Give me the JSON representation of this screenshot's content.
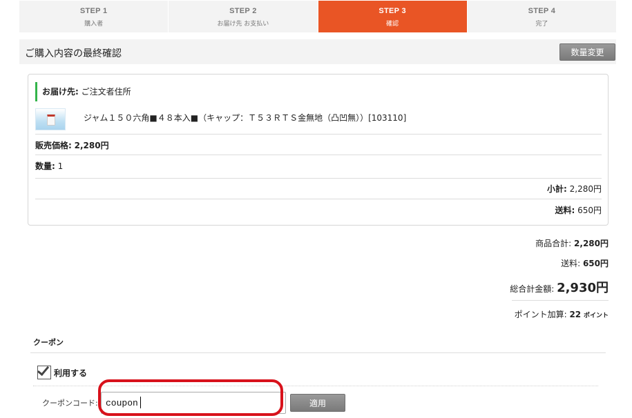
{
  "steps": [
    {
      "num": "STEP 1",
      "label": "購入者"
    },
    {
      "num": "STEP 2",
      "label": "お届け先 お支払い"
    },
    {
      "num": "STEP 3",
      "label": "確認"
    },
    {
      "num": "STEP 4",
      "label": "完了"
    }
  ],
  "active_step_color": "#e95525",
  "section": {
    "title": "ご購入内容の最終確認",
    "qty_change_button": "数量変更"
  },
  "order": {
    "destination_label": "お届け先:",
    "destination_value": "ご注文者住所",
    "product_name": "ジャム１５０六角■４８本入■（キャップ：Ｔ５３ＲＴＳ金無地（凸凹無））[103110]",
    "price_label": "販売価格:",
    "price_value": "2,280円",
    "qty_label": "数量:",
    "qty_value": "1",
    "subtotal_label": "小計:",
    "subtotal_value": "2,280円",
    "shipping_label": "送料:",
    "shipping_value": "650円"
  },
  "totals": {
    "items_total_label": "商品合計:",
    "items_total_value": "2,280円",
    "shipping_label": "送料:",
    "shipping_value": "650円",
    "grand_total_label": "総合計金額:",
    "grand_total_value": "2,930円",
    "points_label": "ポイント加算:",
    "points_value": "22",
    "points_unit": "ポイント"
  },
  "coupon": {
    "title": "クーポン",
    "use_label": "利用する",
    "use_checked": true,
    "code_label": "クーポンコード:",
    "code_value": "coupon",
    "apply_button": "適用"
  },
  "colors": {
    "accent": "#e95525",
    "destination_bar": "#33b44a",
    "highlight": "#d8111b"
  }
}
